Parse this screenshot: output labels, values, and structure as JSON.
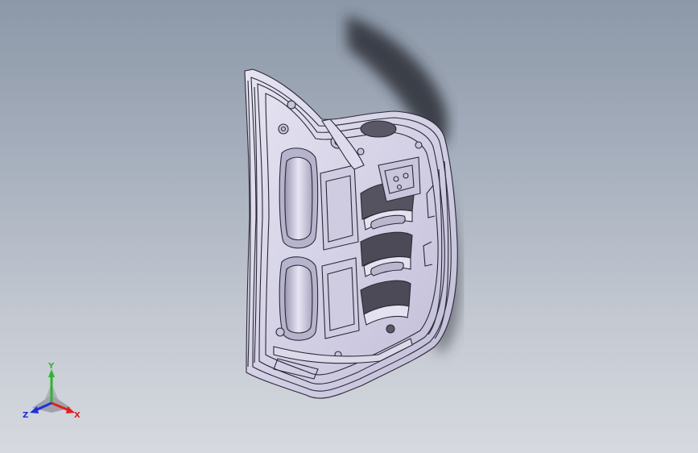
{
  "viewport": {
    "background_top": "#8c98a8",
    "background_bottom": "#d6d9df",
    "model_color": "#d8d6ea",
    "edge_color": "#2a2a36",
    "shadow_color": "#3a3d44"
  },
  "triad": {
    "x_label": "X",
    "y_label": "Y",
    "z_label": "Z",
    "x_color": "#e02020",
    "y_color": "#2fb52f",
    "z_color": "#2030d8"
  }
}
